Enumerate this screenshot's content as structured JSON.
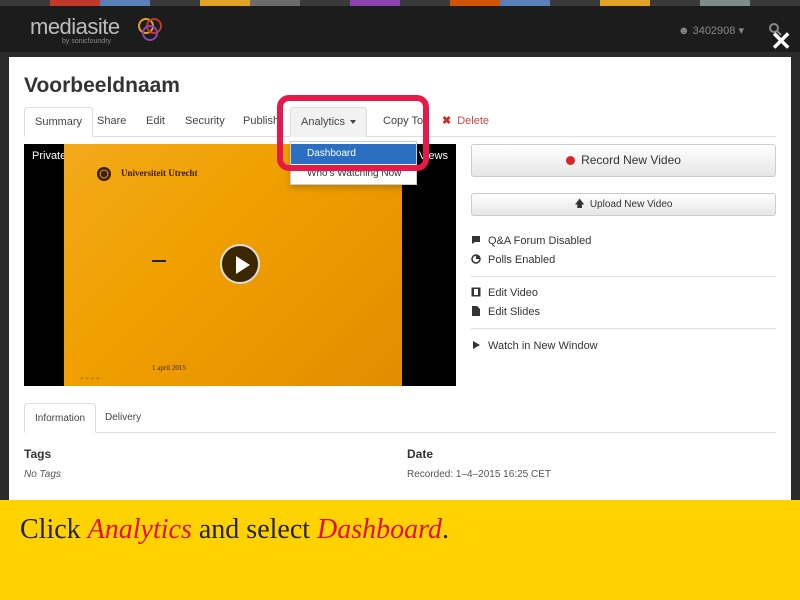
{
  "header": {
    "logo_text": "mediasite",
    "logo_sub": "by sonicfoundry",
    "user_id": "3402908",
    "strip_colors": [
      "#3a3a3a",
      "#c0392b",
      "#5b7fb8",
      "#3a3a3a",
      "#e1a325",
      "#6c6c6c",
      "#3a3a3a",
      "#8e44ad",
      "#3a3a3a",
      "#d35400",
      "#5b7fb8",
      "#3a3a3a",
      "#e1a325",
      "#3a3a3a",
      "#7f8c8d",
      "#3a3a3a"
    ]
  },
  "modal": {
    "title": "Voorbeeldnaam",
    "tabs": [
      {
        "label": "Summary"
      },
      {
        "label": "Share"
      },
      {
        "label": "Edit"
      },
      {
        "label": "Security"
      },
      {
        "label": "Publish"
      },
      {
        "label": "Analytics"
      },
      {
        "label": "Copy To"
      },
      {
        "label": "Delete"
      }
    ],
    "analytics_menu": {
      "items": [
        {
          "label": "Dashboard",
          "selected": true
        },
        {
          "label": "Who's Watching Now",
          "selected": false
        }
      ]
    },
    "video": {
      "privacy_label": "Private",
      "views_label": "Views",
      "slide_title": "Universiteit Utrecht",
      "slide_dash": "–",
      "slide_date": "1 april 2015"
    },
    "actions": {
      "record_label": "Record New Video",
      "upload_label": "Upload New Video",
      "qa_label": "Q&A Forum Disabled",
      "polls_label": "Polls Enabled",
      "edit_video_label": "Edit Video",
      "edit_slides_label": "Edit Slides",
      "watch_label": "Watch in New Window"
    },
    "info": {
      "tabs": [
        {
          "label": "Information"
        },
        {
          "label": "Delivery"
        }
      ],
      "tags_heading": "Tags",
      "tags_value": "No Tags",
      "date_heading": "Date",
      "date_value": "Recorded: 1–4–2015 16:25 CET"
    }
  },
  "caption": {
    "prefix": "Click ",
    "analytics": "Analytics",
    "middle": " and select ",
    "dashboard": "Dashboard",
    "suffix": "."
  },
  "colors": {
    "highlight": "#e5194a",
    "caption_bg": "#ffd200",
    "caption_emphasis": "#e0103a",
    "menu_selected": "#2a6fc0",
    "record_dot": "#d9232d"
  }
}
